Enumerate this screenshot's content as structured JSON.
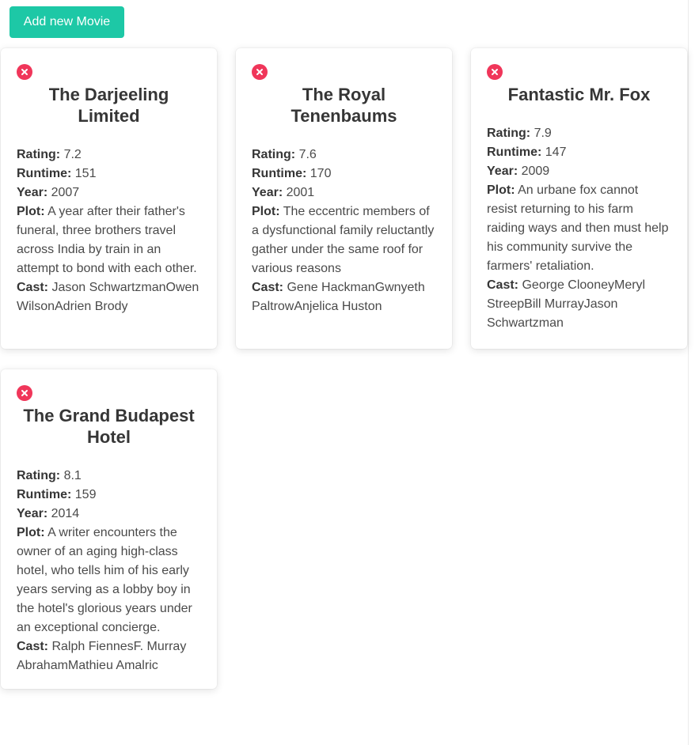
{
  "header": {
    "add_button_label": "Add new Movie"
  },
  "labels": {
    "rating": "Rating:",
    "runtime": "Runtime:",
    "year": "Year:",
    "plot": "Plot:",
    "cast": "Cast:"
  },
  "colors": {
    "accent": "#1dc8a6",
    "delete": "#f0365a"
  },
  "movies": [
    {
      "title": "The Darjeeling Limited",
      "rating": "7.2",
      "runtime": "151",
      "year": "2007",
      "plot": "A year after their father's funeral, three brothers travel across India by train in an attempt to bond with each other.",
      "cast": "Jason SchwartzmanOwen WilsonAdrien Brody"
    },
    {
      "title": "The Royal Tenenbaums",
      "rating": "7.6",
      "runtime": "170",
      "year": "2001",
      "plot": "The eccentric members of a dysfunctional family reluctantly gather under the same roof for various reasons",
      "cast": "Gene HackmanGwnyeth PaltrowAnjelica Huston"
    },
    {
      "title": "Fantastic Mr. Fox",
      "rating": "7.9",
      "runtime": "147",
      "year": "2009",
      "plot": "An urbane fox cannot resist returning to his farm raiding ways and then must help his community survive the farmers' retaliation.",
      "cast": "George ClooneyMeryl StreepBill MurrayJason Schwartzman"
    },
    {
      "title": "The Grand Budapest Hotel",
      "rating": "8.1",
      "runtime": "159",
      "year": "2014",
      "plot": "A writer encounters the owner of an aging high-class hotel, who tells him of his early years serving as a lobby boy in the hotel's glorious years under an exceptional concierge.",
      "cast": "Ralph FiennesF. Murray AbrahamMathieu Amalric"
    }
  ]
}
